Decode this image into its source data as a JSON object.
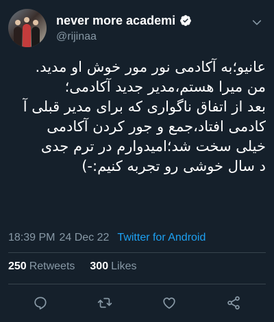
{
  "author": {
    "display_name": "never more academi",
    "handle": "@rijinaa",
    "verified": true
  },
  "tweet": {
    "lines": [
      "عانیو؛به آکادمی نور مور خوش او مدید.",
      "من میرا هستم،مدیر جدید آکادمی؛",
      "بعد از اتفاق ناگواری که برای مدیر قبلی آ",
      "کادمی افتاد،جمع و جور کردن آکادمی",
      "خیلی سخت شد؛امیدوارم در ترم جدی",
      "د سال خوشی رو تجربه کنیم:-)"
    ],
    "time": "18:39 PM",
    "date": "24 Dec 22",
    "source": "Twitter for Android"
  },
  "stats": {
    "retweets_count": "250",
    "retweets_label": "Retweets",
    "likes_count": "300",
    "likes_label": "Likes"
  },
  "actions": [
    {
      "icon": "reply-icon"
    },
    {
      "icon": "retweet-icon"
    },
    {
      "icon": "like-icon"
    },
    {
      "icon": "share-icon"
    }
  ],
  "colors": {
    "background": "#15202b",
    "secondary_text": "#8899a6",
    "accent": "#1da1f2",
    "divider": "#38444d"
  }
}
